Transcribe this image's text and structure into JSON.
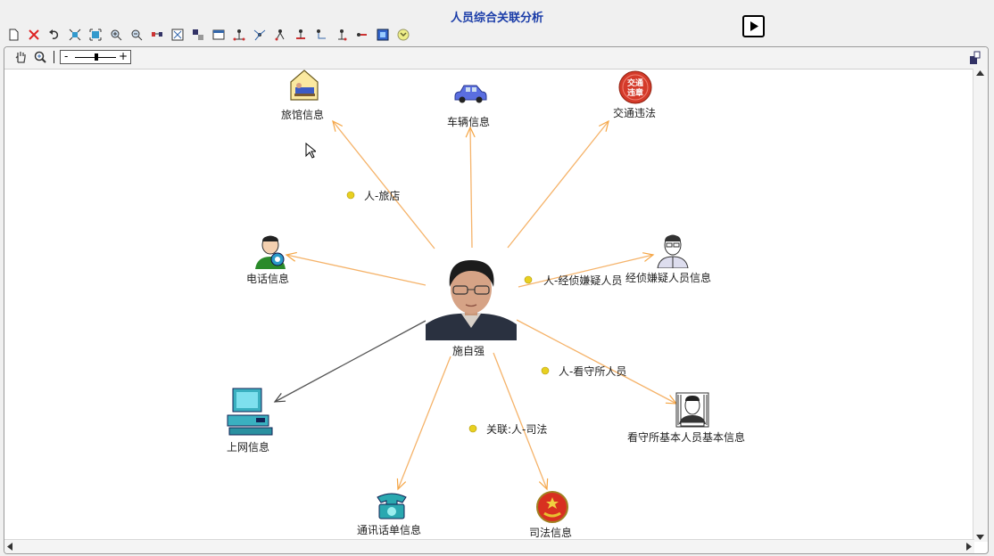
{
  "window": {
    "title": "人员综合关联分析"
  },
  "toolbar": {
    "icons": [
      "new-icon",
      "delete-icon",
      "undo-icon",
      "fit-icon",
      "expand-icon",
      "zoom-in-icon",
      "zoom-out-icon",
      "link-icon",
      "layout-icon",
      "filter-icon",
      "table-icon",
      "tree-layout-icon",
      "radial-layout-icon",
      "hier-layout-icon",
      "org-layout-icon",
      "circle-layout-icon",
      "group-layout-icon",
      "path-icon",
      "export-icon",
      "settings-icon",
      "collapse-icon"
    ]
  },
  "zoom_slider": {
    "minus": "-",
    "plus": "+"
  },
  "graph": {
    "center": {
      "label": "施自强"
    },
    "nodes": [
      {
        "id": "hotel",
        "label": "旅馆信息"
      },
      {
        "id": "vehicle",
        "label": "车辆信息"
      },
      {
        "id": "traffic",
        "label": "交通违法",
        "icon_text": [
          "交通",
          "违章"
        ]
      },
      {
        "id": "phone",
        "label": "电话信息"
      },
      {
        "id": "suspect",
        "label": "经侦嫌疑人员信息"
      },
      {
        "id": "internet",
        "label": "上网信息"
      },
      {
        "id": "detention",
        "label": "看守所基本人员基本信息"
      },
      {
        "id": "callrecord",
        "label": "通讯话单信息"
      },
      {
        "id": "judicial",
        "label": "司法信息"
      }
    ],
    "relations": [
      {
        "label": "人-旅店"
      },
      {
        "label": "人-经侦嫌疑人员"
      },
      {
        "label": "人-看守所人员"
      },
      {
        "label": "关联:人-司法"
      }
    ]
  }
}
